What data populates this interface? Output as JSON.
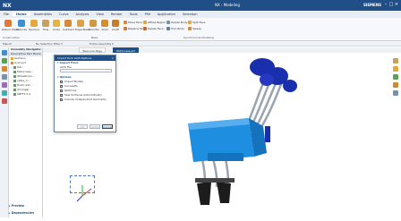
{
  "title_bar": {
    "brand": "NX",
    "title": "NX - Modeling",
    "company": "SIEMENS",
    "minimize": "–",
    "maximize": "□",
    "close": "×"
  },
  "menu": [
    "File",
    "Home",
    "Assemblies",
    "Curve",
    "Analysis",
    "View",
    "Render",
    "Tools",
    "PMI",
    "Application",
    "Selection"
  ],
  "ribbon": {
    "large_buttons": [
      "Datum Plane",
      "Extrude",
      "Revolve",
      "Hole",
      "Unite",
      "Subtract",
      "Edge Blend",
      "Chamfer",
      "Shell",
      "Draft"
    ],
    "small_buttons": [
      "Move Face",
      "Offset Region",
      "Replace Face",
      "Delete Face",
      "Delete Body",
      "Trim Body",
      "Split Face",
      "Sweep"
    ],
    "groups": [
      "Construction",
      "Base",
      "Synchronous Modeling"
    ]
  },
  "toolbar_row": {
    "filter": "Menu▾",
    "scope": "No Selection Filter ▾",
    "assembly": "Entire Assembly ▾"
  },
  "navigator": {
    "header": "Assembly Navigator",
    "column": "Descriptive Part Name",
    "items": [
      "Sections",
      "Ucan.prt",
      "ISO…",
      "Motorcase…",
      "Wheelhous…",
      "cable_cr…",
      "Hoist unit…",
      "drivinggr…",
      "XRTF1 0-2"
    ]
  },
  "tabs": [
    "Welcome Page",
    "Motorcase.prt"
  ],
  "dialog": {
    "title": "Import from ACIS Options",
    "sections": {
      "import_from": "Import From",
      "options": "Options"
    },
    "file_label": "ACIS File",
    "options": [
      {
        "label": "Import Bodies",
        "checked": true
      },
      {
        "label": "Curves/Ps",
        "checked": false
      },
      {
        "label": "Optimize",
        "checked": false
      },
      {
        "label": "Sew Surfaces Automatically",
        "checked": true
      },
      {
        "label": "Include Independent Geometry",
        "checked": true
      }
    ],
    "buttons": {
      "ok": "OK",
      "apply": "Apply",
      "cancel": "Cancel"
    }
  },
  "bottom_panels": [
    "Preview",
    "Dependencies"
  ],
  "colors": {
    "accent": "#1f4f86",
    "model_blue": "#1e8ee0",
    "model_dark_blue": "#1a2fae",
    "model_gray": "#9aa4b0",
    "model_black": "#1c1c1c"
  }
}
